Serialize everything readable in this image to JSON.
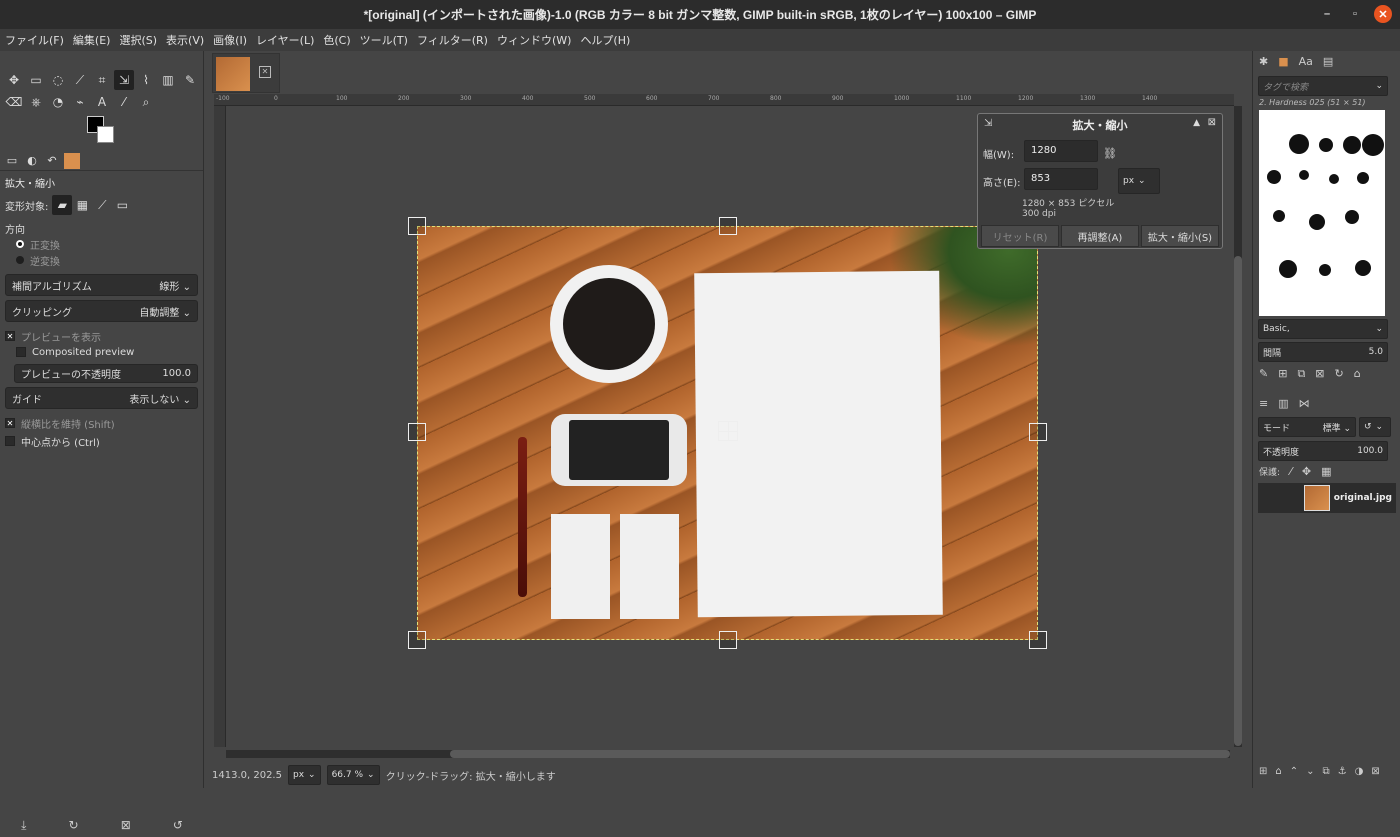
{
  "window": {
    "title": "*[original] (インポートされた画像)-1.0 (RGB カラー 8 bit ガンマ整数, GIMP built-in sRGB, 1枚のレイヤー) 100x100 – GIMP",
    "min": "–",
    "max": "▫",
    "close": "✕"
  },
  "menu": [
    "ファイル(F)",
    "編集(E)",
    "選択(S)",
    "表示(V)",
    "画像(I)",
    "レイヤー(L)",
    "色(C)",
    "ツール(T)",
    "フィルター(R)",
    "ウィンドウ(W)",
    "ヘルプ(H)"
  ],
  "tool_options": {
    "title": "拡大・縮小",
    "transform_label": "変形対象:",
    "direction_label": "方向",
    "direction_forward": "正変換",
    "direction_backward": "逆変換",
    "interp_label": "補間アルゴリズム",
    "interp_value": "線形",
    "clip_label": "クリッピング",
    "clip_value": "自動調整",
    "show_preview": "プレビューを表示",
    "composited_preview": "Composited preview",
    "preview_opacity_label": "プレビューの不透明度",
    "preview_opacity_value": "100.0",
    "guide_label": "ガイド",
    "guide_value": "表示しない",
    "keep_aspect": "縦横比を維持 (Shift)",
    "from_center": "中心点から (Ctrl)"
  },
  "ruler_ticks": [
    "-100",
    "0",
    "100",
    "200",
    "300",
    "400",
    "500",
    "600",
    "700",
    "800",
    "900",
    "1000",
    "1100",
    "1200",
    "1300",
    "1400"
  ],
  "scale_dialog": {
    "title": "拡大・縮小",
    "width_label": "幅(W):",
    "width_value": "1280",
    "height_label": "高さ(E):",
    "height_value": "853",
    "unit": "px",
    "size_info": "1280 × 853 ピクセル",
    "dpi_info": "300 dpi",
    "reset": "リセット(R)",
    "readjust": "再調整(A)",
    "scale": "拡大・縮小(S)"
  },
  "status": {
    "coords": "1413.0, 202.5",
    "unit": "px",
    "zoom": "66.7 %",
    "message": "クリック-ドラッグ: 拡大・縮小します"
  },
  "brushes": {
    "tag_placeholder": "タグで検索",
    "current_brush": "2. Hardness 025 (51 × 51)",
    "preset": "Basic,",
    "spacing_label": "間隔",
    "spacing_value": "5.0"
  },
  "layers": {
    "mode_label": "モード",
    "mode_value": "標準",
    "opacity_label": "不透明度",
    "opacity_value": "100.0",
    "lock_label": "保護:",
    "layer_name": "original.jpg"
  },
  "colors": {
    "accent": "#e95420",
    "panel": "#454545",
    "dark": "#2c2c2c"
  }
}
